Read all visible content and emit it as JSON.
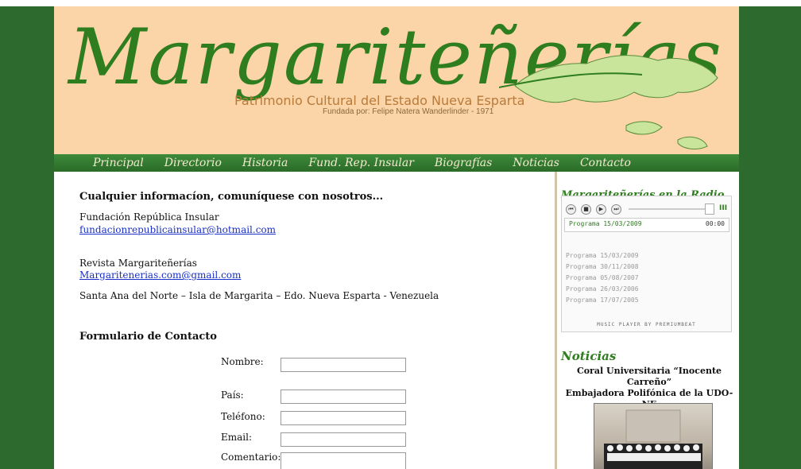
{
  "header": {
    "logo_text": "Margariteñerías",
    "subtitle": "Patrimonio Cultural del Estado Nueva Esparta",
    "founded": "Fundada por: Felipe Natera Wanderlinder - 1971"
  },
  "nav": {
    "items": [
      "Principal",
      "Directorio",
      "Historia",
      "Fund. Rep. Insular",
      "Biografías",
      "Noticias",
      "Contacto"
    ]
  },
  "main": {
    "heading": "Cualquier informacíon, comuníquese con nosotros...",
    "org1": "Fundación República Insular",
    "email1": "fundacionrepublicainsular@hotmail.com",
    "org2": "Revista Margariteñerías",
    "email2": "Margaritenerias.com@gmail.com",
    "address": "Santa Ana del Norte – Isla de Margarita – Edo. Nueva Esparta - Venezuela",
    "form_title": "Formulario de Contacto",
    "form": {
      "nombre": "Nombre:",
      "pais": "País:",
      "telefono": "Teléfono:",
      "email": "Email:",
      "comentario": "Comentario:"
    }
  },
  "sidebar": {
    "radio_title": "Margariteñerías en la Radio",
    "player": {
      "now_title": "Programa 15/03/2009",
      "now_time": "00:00",
      "playlist": [
        "Programa 15/03/2009",
        "Programa 30/11/2008",
        "Programa 05/08/2007",
        "Programa 26/03/2006",
        "Programa 17/07/2005"
      ],
      "credit": "MUSIC PLAYER BY PREMIUMBEAT"
    },
    "news_title": "Noticias",
    "news_headline_1": "Coral Universitaria “Inocente Carreño”",
    "news_headline_2": "Embajadora Polifónica de la UDO-NE"
  },
  "colors": {
    "background": "#2d6a2e",
    "header": "#fbd5a8",
    "accent_green": "#2e7d1e",
    "link": "#1a30c8"
  }
}
